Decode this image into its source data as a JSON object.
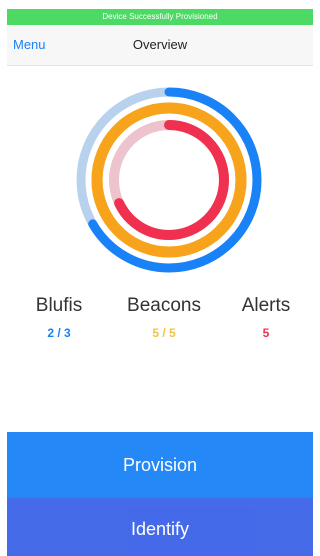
{
  "status_banner": "Device Successfully Provisioned",
  "nav": {
    "menu_label": "Menu",
    "title": "Overview"
  },
  "rings": {
    "blufis": {
      "fraction": 0.6667,
      "color": "#1a82f7",
      "track_color": "#b8d2ee"
    },
    "beacons": {
      "fraction": 1.0,
      "color": "#f8a31c",
      "track_color": "#f8a31c"
    },
    "alerts": {
      "fraction": 0.68,
      "color": "#f0304f",
      "track_color": "#edc3cd"
    }
  },
  "stats": {
    "blufis": {
      "label": "Blufis",
      "value": "2 / 3",
      "color": "#1a82f7"
    },
    "beacons": {
      "label": "Beacons",
      "value": "5 / 5",
      "color": "#f5c242"
    },
    "alerts": {
      "label": "Alerts",
      "value": "5",
      "color": "#f0304f"
    }
  },
  "buttons": {
    "provision_label": "Provision",
    "identify_label": "Identify"
  }
}
